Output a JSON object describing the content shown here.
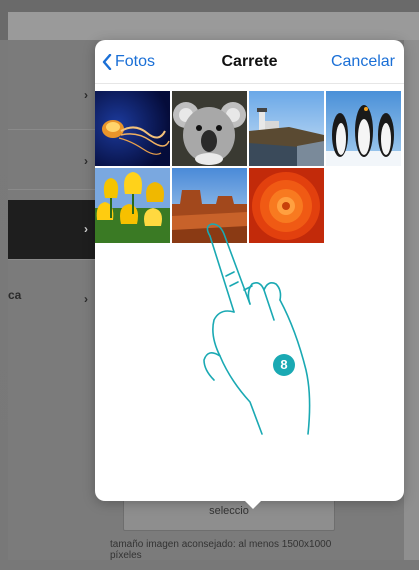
{
  "nav": {
    "back_label": "Fotos",
    "title": "Carrete",
    "cancel_label": "Cancelar"
  },
  "photos": [
    {
      "name": "jellyfish"
    },
    {
      "name": "koala"
    },
    {
      "name": "lighthouse"
    },
    {
      "name": "penguins"
    },
    {
      "name": "tulips"
    },
    {
      "name": "desert"
    },
    {
      "name": "chrysanthemum"
    }
  ],
  "background": {
    "partial_label": "ca",
    "select_button": "seleccio",
    "hint": "tamaño imagen aconsejado: al menos 1500x1000 píxeles"
  },
  "annotation": {
    "step_number": "8"
  },
  "colors": {
    "accent": "#1a6fd6",
    "badge": "#1aa9b3"
  }
}
